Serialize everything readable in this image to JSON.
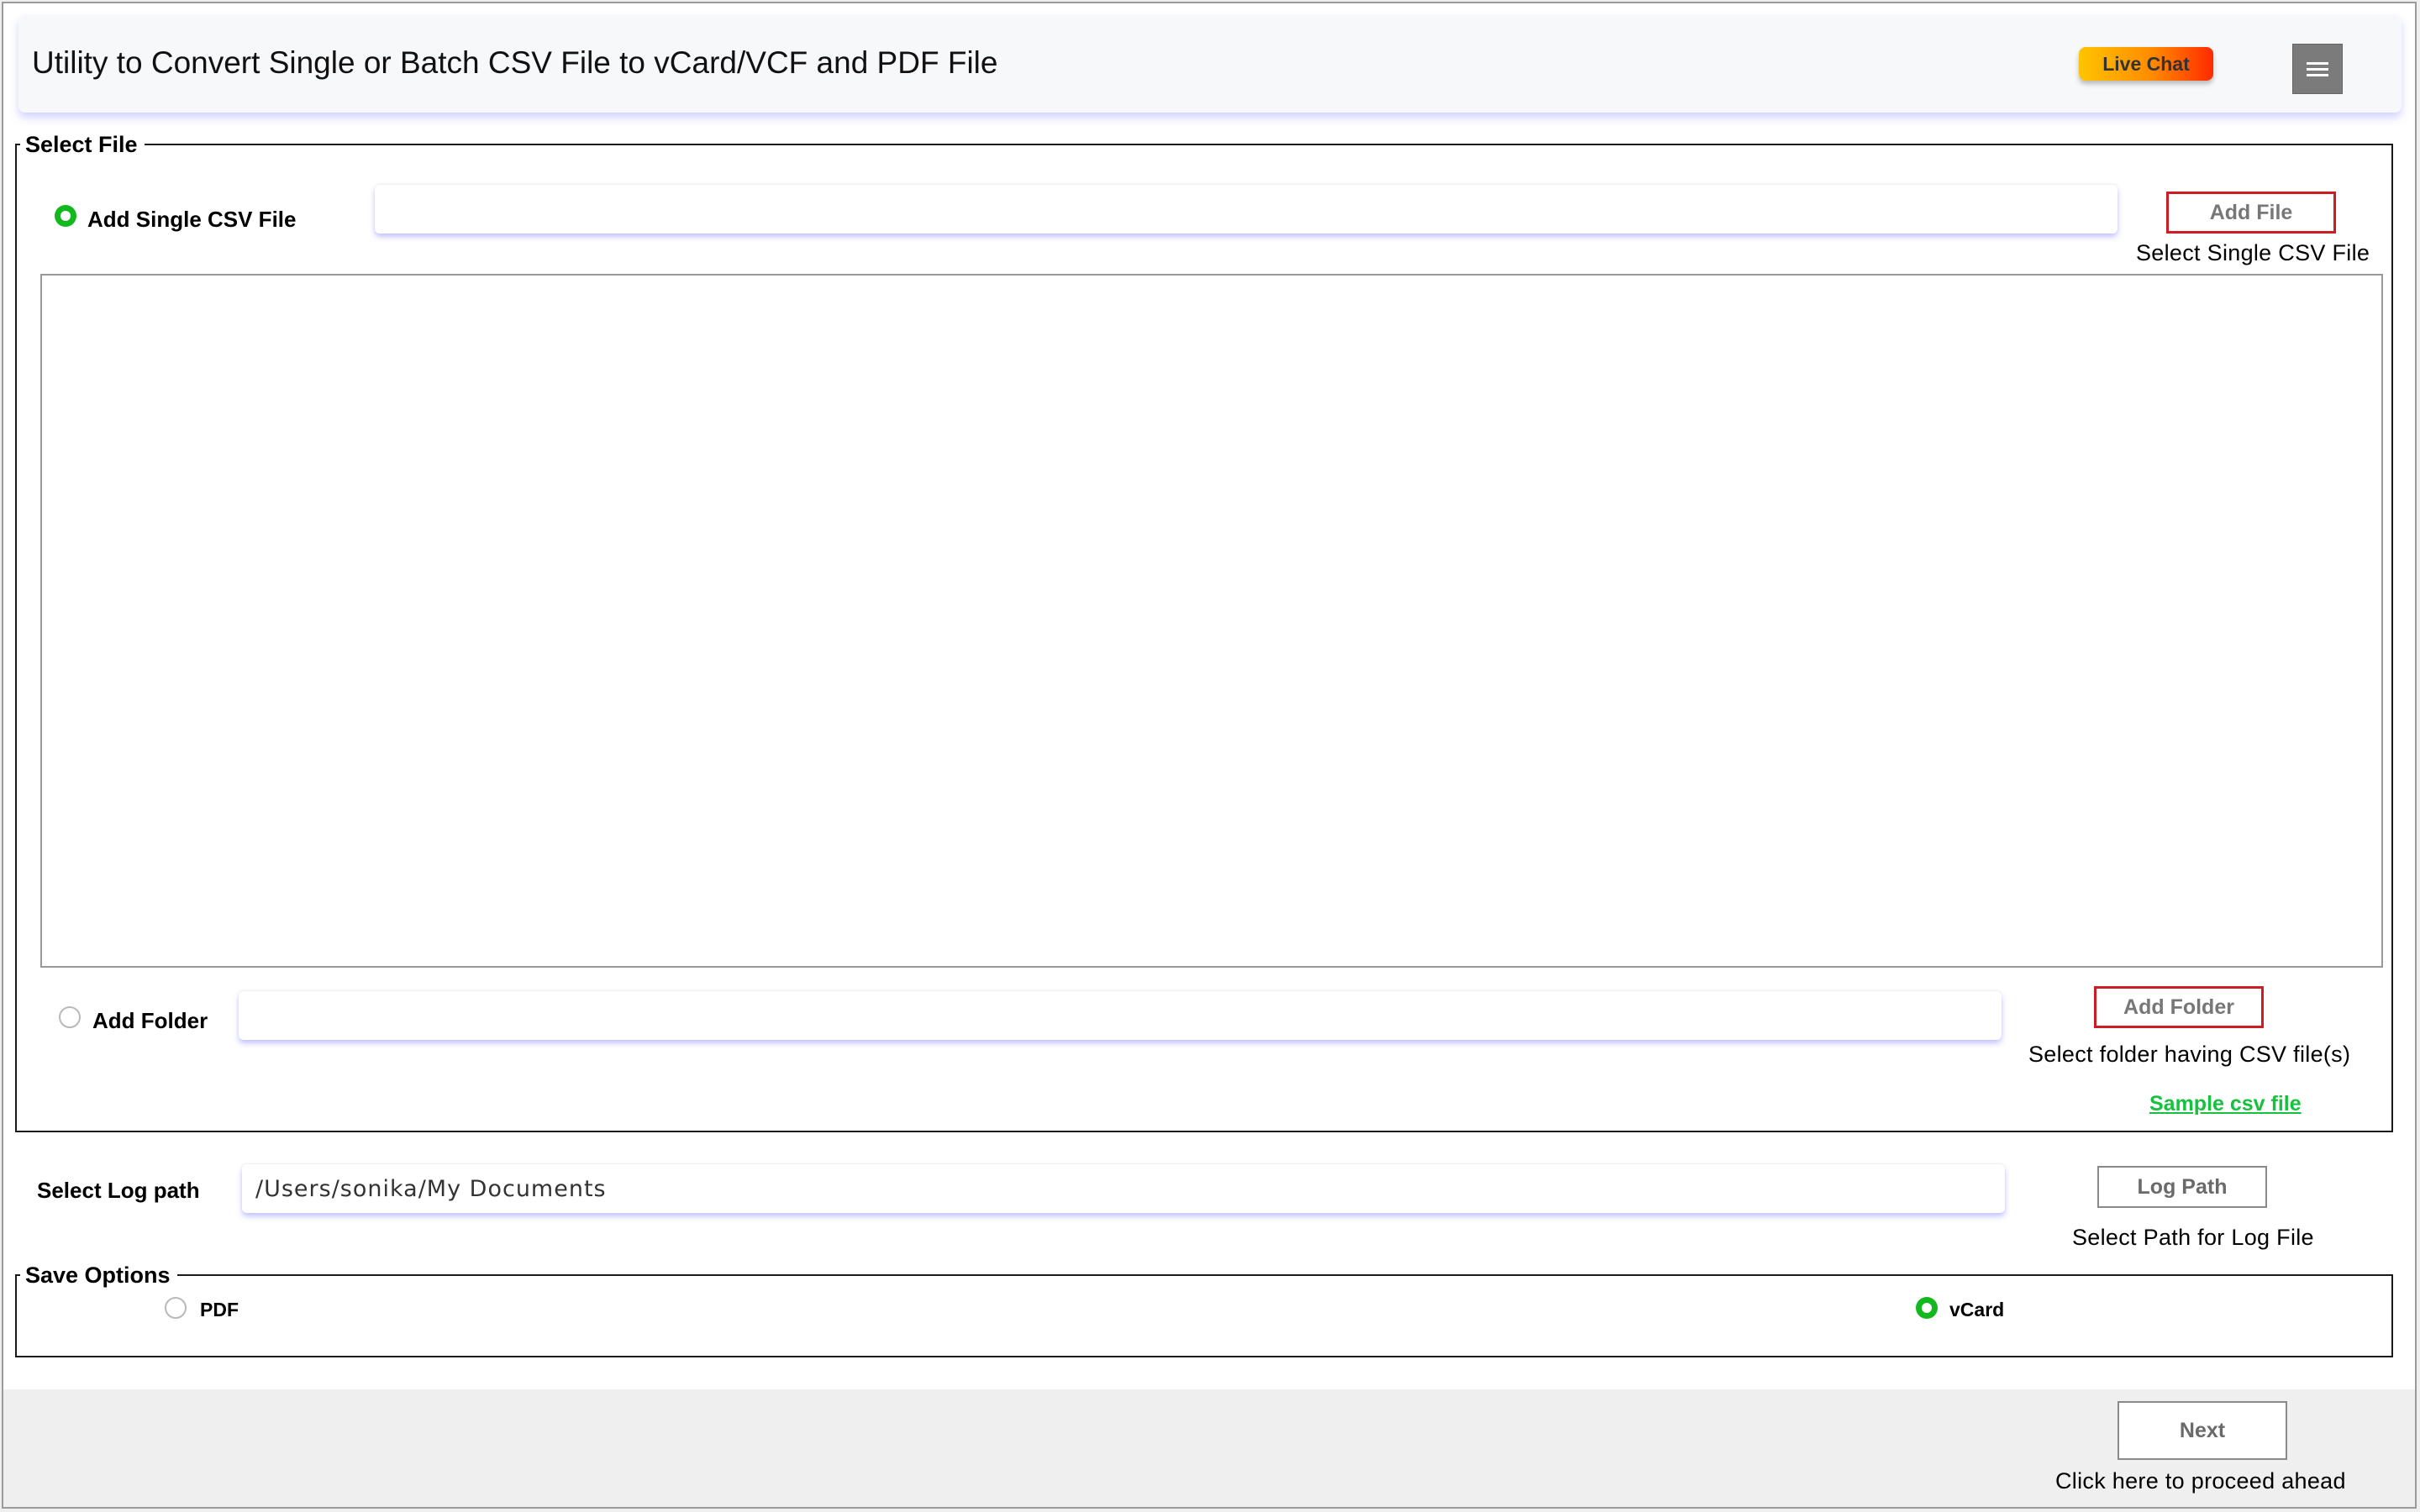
{
  "header": {
    "title": "Utility to Convert Single or Batch CSV File to vCard/VCF and PDF File",
    "live_chat_label": "Live Chat",
    "menu_icon": "hamburger-menu-icon"
  },
  "select_file": {
    "legend": "Select File",
    "single_option": {
      "label": "Add Single CSV File",
      "selected": true,
      "input_value": ""
    },
    "add_file_button": "Add File",
    "add_file_hint": "Select Single CSV File",
    "folder_option": {
      "label": "Add Folder",
      "selected": false,
      "input_value": ""
    },
    "add_folder_button": "Add Folder",
    "add_folder_hint": "Select folder having CSV file(s)",
    "sample_link": "Sample csv file"
  },
  "log_path": {
    "label": "Select Log path",
    "value": "/Users/sonika/My Documents",
    "button": "Log Path",
    "hint": "Select Path for Log File"
  },
  "save_options": {
    "legend": "Save Options",
    "options": [
      {
        "label": "PDF",
        "selected": false
      },
      {
        "label": "vCard",
        "selected": true
      }
    ]
  },
  "footer": {
    "next_button": "Next",
    "next_hint": "Click here to proceed ahead"
  },
  "colors": {
    "accent_green": "#13b81f",
    "link_green": "#16c23d",
    "button_border_red": "#cc1c24",
    "menu_gray": "#7b7b7b"
  }
}
